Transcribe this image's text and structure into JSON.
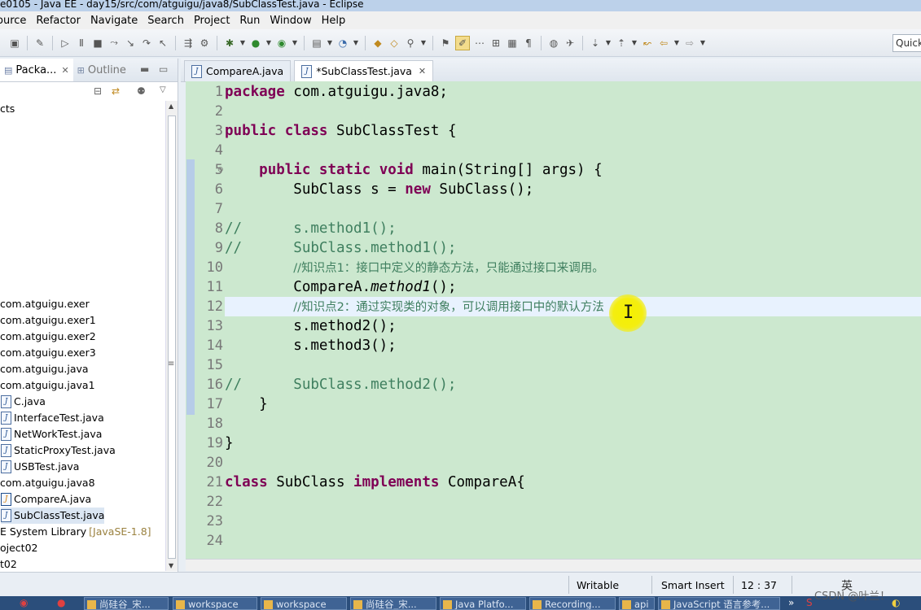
{
  "window": {
    "title": "e0105 - Java EE - day15/src/com/atguigu/java8/SubClassTest.java - Eclipse"
  },
  "menu": [
    "ource",
    "Refactor",
    "Navigate",
    "Search",
    "Project",
    "Run",
    "Window",
    "Help"
  ],
  "toolbar": {
    "quick_access": "Quick"
  },
  "left_panel": {
    "tabs": [
      {
        "label": "Packa...",
        "active": true
      },
      {
        "label": "Outline",
        "active": false
      }
    ],
    "tree": [
      {
        "label": "cts",
        "icon": "none",
        "row": 0
      },
      {
        "label": "com.atguigu.exer",
        "icon": "package",
        "row": 12
      },
      {
        "label": "com.atguigu.exer1",
        "icon": "package",
        "row": 13
      },
      {
        "label": "com.atguigu.exer2",
        "icon": "package",
        "row": 14
      },
      {
        "label": "com.atguigu.exer3",
        "icon": "package",
        "row": 15
      },
      {
        "label": "com.atguigu.java",
        "icon": "package",
        "row": 16
      },
      {
        "label": "com.atguigu.java1",
        "icon": "package",
        "row": 17
      },
      {
        "label": "C.java",
        "icon": "java-file",
        "row": 18
      },
      {
        "label": "InterfaceTest.java",
        "icon": "java-file",
        "row": 19
      },
      {
        "label": "NetWorkTest.java",
        "icon": "java-file",
        "row": 20
      },
      {
        "label": "StaticProxyTest.java",
        "icon": "java-file",
        "row": 21
      },
      {
        "label": "USBTest.java",
        "icon": "java-file",
        "row": 22
      },
      {
        "label": "com.atguigu.java8",
        "icon": "package",
        "row": 23
      },
      {
        "label": "CompareA.java",
        "icon": "java-file-modified",
        "row": 24
      },
      {
        "label": "SubClassTest.java",
        "icon": "java-file",
        "row": 25,
        "selected": true
      },
      {
        "label": "E System Library",
        "suffix": "[JavaSE-1.8]",
        "icon": "library",
        "row": 26
      },
      {
        "label": "oject02",
        "icon": "none",
        "row": 27
      },
      {
        "label": "t02",
        "icon": "none",
        "row": 28
      }
    ]
  },
  "editor": {
    "tabs": [
      {
        "label": "CompareA.java",
        "active": false
      },
      {
        "label": "*SubClassTest.java",
        "active": true
      }
    ],
    "current_line": 12,
    "lines": [
      {
        "n": "1",
        "tokens": [
          [
            "kw",
            "package"
          ],
          [
            "t",
            " com.atguigu.java8;"
          ]
        ]
      },
      {
        "n": "2",
        "tokens": []
      },
      {
        "n": "3",
        "tokens": [
          [
            "kw",
            "public"
          ],
          [
            "t",
            " "
          ],
          [
            "kw",
            "class"
          ],
          [
            "t",
            " SubClassTest {"
          ]
        ]
      },
      {
        "n": "4",
        "tokens": []
      },
      {
        "n": "5",
        "tokens": [
          [
            "t",
            "    "
          ],
          [
            "kw",
            "public"
          ],
          [
            "t",
            " "
          ],
          [
            "kw",
            "static"
          ],
          [
            "t",
            " "
          ],
          [
            "kw",
            "void"
          ],
          [
            "t",
            " main(String[] args) {"
          ]
        ]
      },
      {
        "n": "6",
        "tokens": [
          [
            "t",
            "        SubClass s = "
          ],
          [
            "kw",
            "new"
          ],
          [
            "t",
            " SubClass();"
          ]
        ]
      },
      {
        "n": "7",
        "tokens": []
      },
      {
        "n": "8",
        "tokens": [
          [
            "cm",
            "//      s.method1();"
          ]
        ]
      },
      {
        "n": "9",
        "tokens": [
          [
            "cm",
            "//      SubClass.method1();"
          ]
        ]
      },
      {
        "n": "10",
        "tokens": [
          [
            "t",
            "        "
          ],
          [
            "cnc",
            "//知识点1：接口中定义的静态方法，只能通过接口来调用。"
          ]
        ]
      },
      {
        "n": "11",
        "tokens": [
          [
            "t",
            "        CompareA."
          ],
          [
            "it",
            "method1"
          ],
          [
            "t",
            "();"
          ]
        ]
      },
      {
        "n": "12",
        "tokens": [
          [
            "t",
            "        "
          ],
          [
            "cnc",
            "//知识点2：通过实现类的对象，可以调用接口中的默认方法"
          ]
        ]
      },
      {
        "n": "13",
        "tokens": [
          [
            "t",
            "        s.method2();"
          ]
        ]
      },
      {
        "n": "14",
        "tokens": [
          [
            "t",
            "        s.method3();"
          ]
        ]
      },
      {
        "n": "15",
        "tokens": []
      },
      {
        "n": "16",
        "tokens": [
          [
            "cm",
            "//      SubClass.method2();"
          ]
        ]
      },
      {
        "n": "17",
        "tokens": [
          [
            "t",
            "    }"
          ]
        ]
      },
      {
        "n": "18",
        "tokens": []
      },
      {
        "n": "19",
        "tokens": [
          [
            "t",
            "}"
          ]
        ]
      },
      {
        "n": "20",
        "tokens": []
      },
      {
        "n": "21",
        "tokens": [
          [
            "kw",
            "class"
          ],
          [
            "t",
            " SubClass "
          ],
          [
            "kw",
            "implements"
          ],
          [
            "t",
            " CompareA{"
          ]
        ]
      },
      {
        "n": "22",
        "tokens": []
      },
      {
        "n": "23",
        "tokens": []
      },
      {
        "n": "24",
        "tokens": []
      }
    ]
  },
  "status": {
    "mode": "Writable",
    "insert": "Smart Insert",
    "position": "12 : 37",
    "ime": "英"
  },
  "taskbar": {
    "tasks": [
      "尚硅谷_宋...",
      "workspace",
      "workspace",
      "尚硅谷_宋...",
      "Java Platfo...",
      "Recording...",
      "api",
      "JavaScript 语言参考..."
    ]
  },
  "watermark": "CSDN @叶兰！",
  "colors": {
    "editor_bg": "#cce8cf",
    "keyword": "#7f0055",
    "comment": "#3f7f5f",
    "current_line": "#e8f2fe"
  }
}
